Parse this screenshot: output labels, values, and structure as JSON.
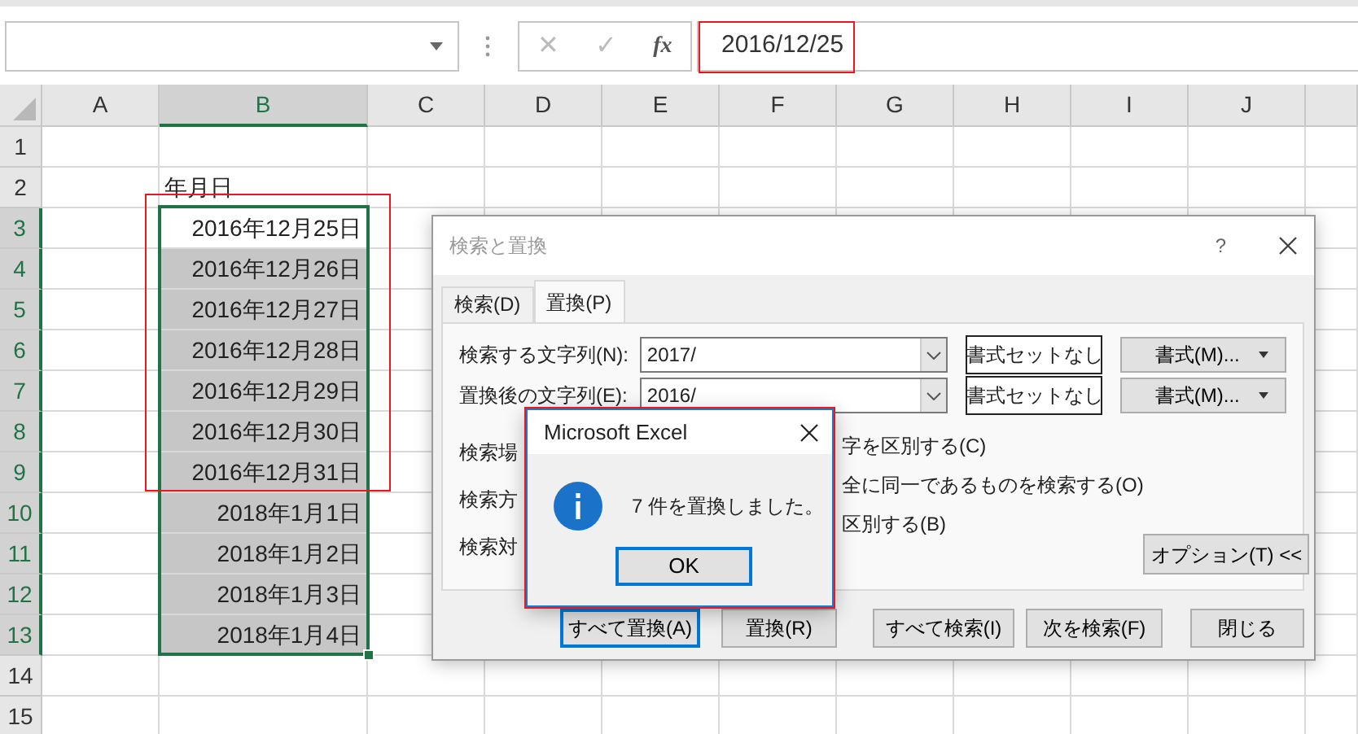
{
  "formula_bar": {
    "cancel": "✕",
    "enter": "✓",
    "function": "fx",
    "value": "2016/12/25"
  },
  "columns": [
    {
      "label": "A",
      "selected": false
    },
    {
      "label": "B",
      "selected": true
    },
    {
      "label": "C",
      "selected": false
    },
    {
      "label": "D",
      "selected": false
    },
    {
      "label": "E",
      "selected": false
    },
    {
      "label": "F",
      "selected": false
    },
    {
      "label": "G",
      "selected": false
    },
    {
      "label": "H",
      "selected": false
    },
    {
      "label": "I",
      "selected": false
    },
    {
      "label": "J",
      "selected": false
    }
  ],
  "rows": [
    {
      "number": "1",
      "selected": false
    },
    {
      "number": "2",
      "selected": false,
      "cell_b": {
        "text": "年月日",
        "highlighted": false,
        "kind": "label"
      }
    },
    {
      "number": "3",
      "selected": true,
      "cell_b": {
        "text": "2016年12月25日",
        "highlighted": false,
        "kind": "date"
      }
    },
    {
      "number": "4",
      "selected": true,
      "cell_b": {
        "text": "2016年12月26日",
        "highlighted": true,
        "kind": "date"
      }
    },
    {
      "number": "5",
      "selected": true,
      "cell_b": {
        "text": "2016年12月27日",
        "highlighted": true,
        "kind": "date"
      }
    },
    {
      "number": "6",
      "selected": true,
      "cell_b": {
        "text": "2016年12月28日",
        "highlighted": true,
        "kind": "date"
      }
    },
    {
      "number": "7",
      "selected": true,
      "cell_b": {
        "text": "2016年12月29日",
        "highlighted": true,
        "kind": "date"
      }
    },
    {
      "number": "8",
      "selected": true,
      "cell_b": {
        "text": "2016年12月30日",
        "highlighted": true,
        "kind": "date"
      }
    },
    {
      "number": "9",
      "selected": true,
      "cell_b": {
        "text": "2016年12月31日",
        "highlighted": true,
        "kind": "date"
      }
    },
    {
      "number": "10",
      "selected": true,
      "cell_b": {
        "text": "2018年1月1日",
        "highlighted": true,
        "kind": "date"
      }
    },
    {
      "number": "11",
      "selected": true,
      "cell_b": {
        "text": "2018年1月2日",
        "highlighted": true,
        "kind": "date"
      }
    },
    {
      "number": "12",
      "selected": true,
      "cell_b": {
        "text": "2018年1月3日",
        "highlighted": true,
        "kind": "date"
      }
    },
    {
      "number": "13",
      "selected": true,
      "cell_b": {
        "text": "2018年1月4日",
        "highlighted": true,
        "kind": "date"
      }
    },
    {
      "number": "14",
      "selected": false
    },
    {
      "number": "15",
      "selected": false
    }
  ],
  "find_replace_dialog": {
    "title": "検索と置換",
    "help": "?",
    "tabs": [
      {
        "label": "検索(D)",
        "selected": false
      },
      {
        "label": "置換(P)",
        "selected": true
      }
    ],
    "fields": [
      {
        "label": "検索する文字列(N):",
        "value": "2017/",
        "format_status": "書式セットなし",
        "format_button": "書式(M)..."
      },
      {
        "label": "置換後の文字列(E):",
        "value": "2016/",
        "format_status": "書式セットなし",
        "format_button": "書式(M)..."
      }
    ],
    "option_labels": [
      "検索場",
      "検索方",
      "検索対"
    ],
    "option_checks": [
      "字を区別する(C)",
      "全に同一であるものを検索する(O)",
      "区別する(B)"
    ],
    "options_button": "オプション(T) <<",
    "buttons": [
      {
        "label": "すべて置換(A)",
        "focused": true
      },
      {
        "label": "置換(R)",
        "focused": false
      },
      {
        "label": "すべて検索(I)",
        "focused": false
      },
      {
        "label": "次を検索(F)",
        "focused": false
      },
      {
        "label": "閉じる",
        "focused": false
      }
    ]
  },
  "message_box": {
    "title": "Microsoft Excel",
    "message": "7 件を置換しました。",
    "button": "OK"
  }
}
